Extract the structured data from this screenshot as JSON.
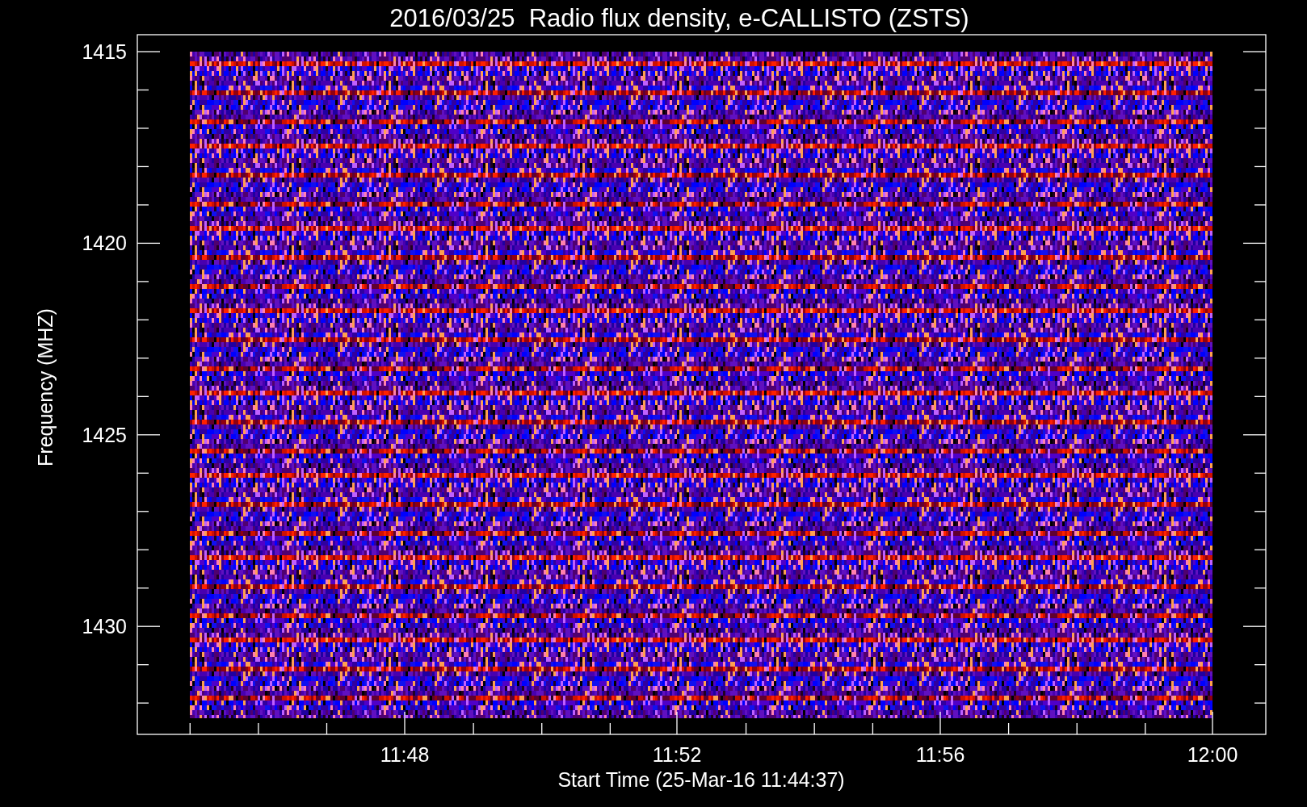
{
  "title": "2016/03/25  Radio flux density, e-CALLISTO (ZSTS)",
  "y_axis": {
    "label": "Frequency (MHZ)",
    "ticks": [
      "1415",
      "1420",
      "1425",
      "1430"
    ]
  },
  "x_axis": {
    "label": "Start Time (25-Mar-16 11:44:37)",
    "ticks": [
      "11:48",
      "11:52",
      "11:56",
      "12:00"
    ]
  }
}
